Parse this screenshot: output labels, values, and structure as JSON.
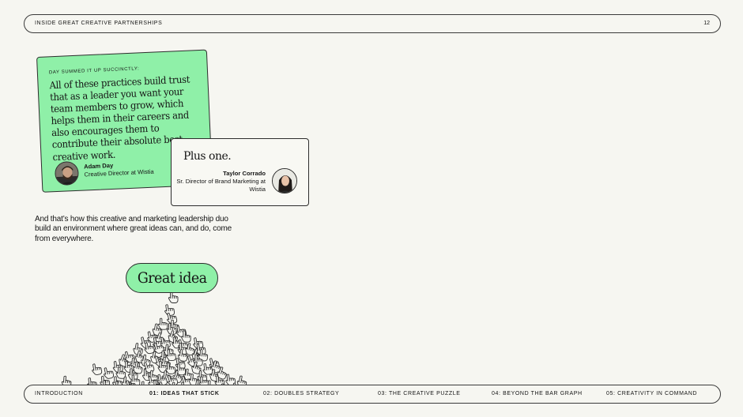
{
  "header": {
    "title": "INSIDE GREAT CREATIVE PARTNERSHIPS",
    "page_number": "12"
  },
  "quote_card": {
    "kicker": "DAY SUMMED IT UP SUCCINCTLY:",
    "quote": "All of these practices build trust that as a leader you want your team members to grow, which helps them in their careers and also encourages them to contribute their absolute best creative work.",
    "person_name": "Adam Day",
    "person_role": "Creative Director at Wistia"
  },
  "reply_card": {
    "text": "Plus one.",
    "person_name": "Taylor Corrado",
    "person_role": "Sr. Director of Brand Marketing at Wistia"
  },
  "body_text": "And that’s how this creative and marketing leadership duo build an environment where great ideas can, and do, come from everywhere.",
  "illustration": {
    "bubble_label": "Great idea",
    "icon": "pointing-hand-icon"
  },
  "footer_nav": {
    "items": [
      {
        "label": "INTRODUCTION"
      },
      {
        "label": "01: IDEAS THAT STICK"
      },
      {
        "label": "02: DOUBLES STRATEGY"
      },
      {
        "label": "03: THE CREATIVE PUZZLE"
      },
      {
        "label": "04: BEYOND THE BAR GRAPH"
      },
      {
        "label": "05: CREATIVITY IN COMMAND"
      }
    ],
    "active_index": 1
  },
  "colors": {
    "accent_green": "#8ff0a8",
    "background": "#f6f6f1",
    "ink": "#151515"
  }
}
